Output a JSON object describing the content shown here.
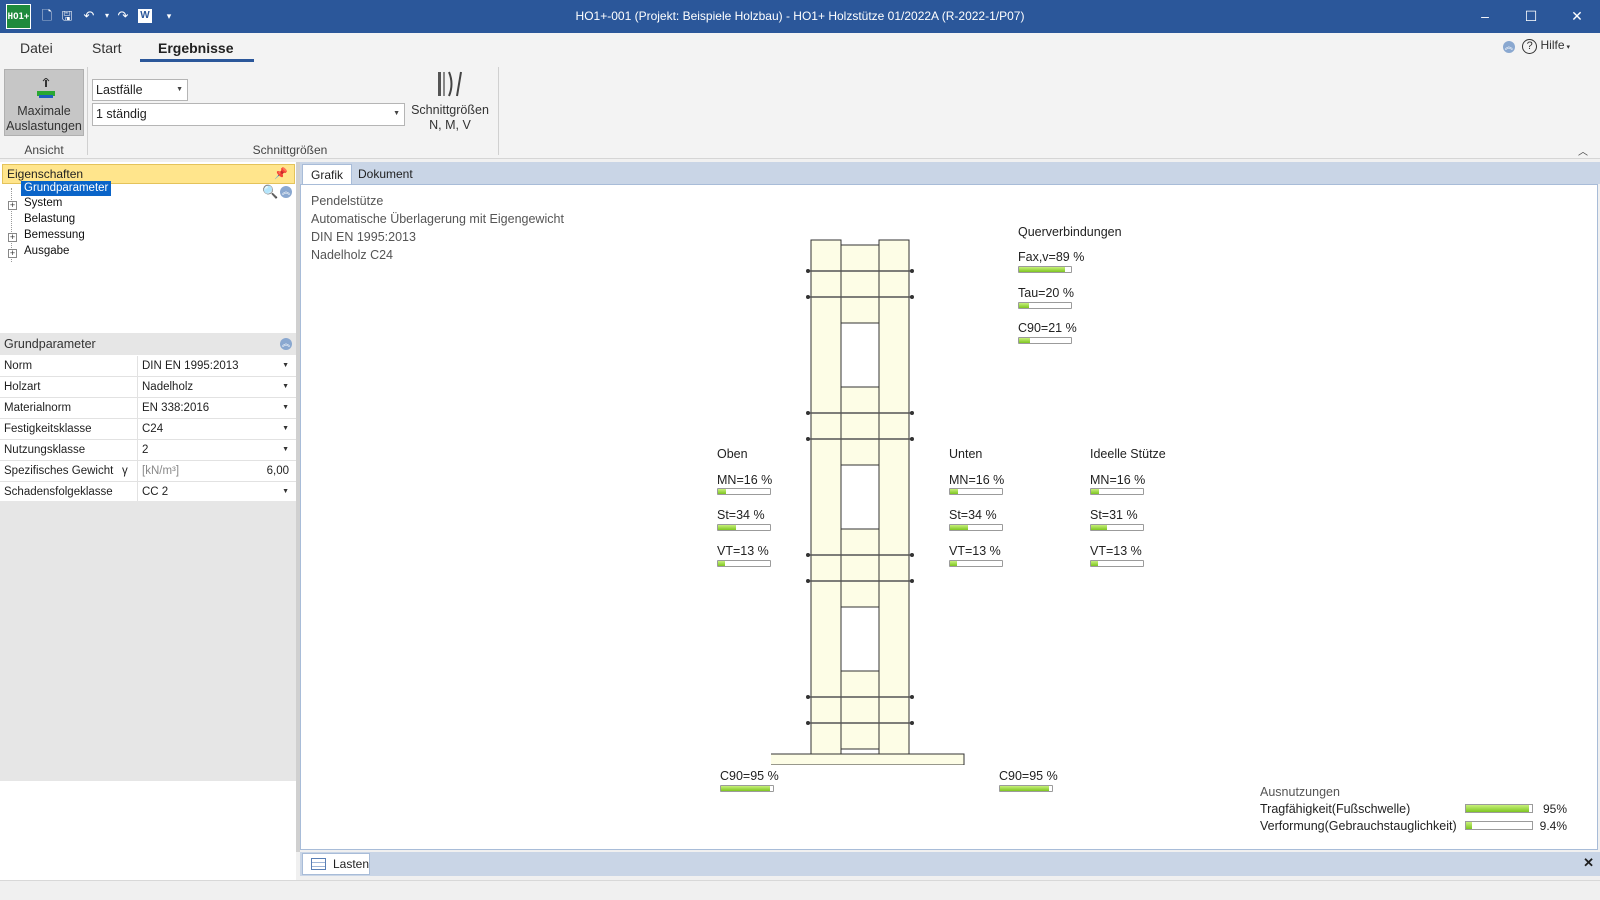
{
  "window": {
    "title": "HO1+-001 (Projekt: Beispiele Holzbau) - HO1+ Holzstütze 01/2022A (R-2022-1/P07)",
    "logo_text": "HO1+",
    "minimize_icon": "–",
    "maximize_icon": "☐",
    "close_icon": "✕"
  },
  "menu": {
    "tabs": [
      "Datei",
      "Start",
      "Ergebnisse"
    ],
    "active_tab": "Ergebnisse",
    "help": "Hilfe"
  },
  "ribbon": {
    "max_btn_line1": "Maximale",
    "max_btn_line2": "Auslastungen",
    "group_ansicht": "Ansicht",
    "dropdown_type": "Lastfälle",
    "dropdown_case": "1 ständig",
    "sg_btn_line1": "Schnittgrößen",
    "sg_btn_line2": "N, M, V",
    "group_schnittgroessen": "Schnittgrößen"
  },
  "left_panel": {
    "header": "Eigenschaften",
    "tree": [
      "Grundparameter",
      "System",
      "Belastung",
      "Bemessung",
      "Ausgabe"
    ],
    "section_title": "Grundparameter",
    "properties": [
      {
        "name": "Norm",
        "value": "DIN EN 1995:2013"
      },
      {
        "name": "Holzart",
        "value": "Nadelholz"
      },
      {
        "name": "Materialnorm",
        "value": "EN 338:2016"
      },
      {
        "name": "Festigkeitsklasse",
        "value": "C24"
      },
      {
        "name": "Nutzungsklasse",
        "value": "2"
      },
      {
        "name": "Spezifisches Gewicht",
        "symbol": "γ",
        "unit": "[kN/m³]",
        "value": "6,00"
      },
      {
        "name": "Schadensfolgeklasse",
        "value": "CC 2"
      }
    ]
  },
  "doc_tabs": [
    "Grafik",
    "Dokument"
  ],
  "graphic": {
    "info": [
      "Pendelstütze",
      "Automatische Überlagerung mit Eigengewicht",
      "DIN EN 1995:2013",
      "Nadelholz C24"
    ],
    "querverbindungen": {
      "title": "Querverbindungen",
      "items": [
        {
          "label": "Fax,v=89 %",
          "value": 0.89
        },
        {
          "label": "Tau=20 %",
          "value": 0.2
        },
        {
          "label": "C90=21 %",
          "value": 0.21
        }
      ]
    },
    "oben": {
      "title": "Oben",
      "items": [
        {
          "label": "MN=16 %",
          "value": 0.16
        },
        {
          "label": "St=34 %",
          "value": 0.34
        },
        {
          "label": "VT=13 %",
          "value": 0.13
        }
      ]
    },
    "unten": {
      "title": "Unten",
      "items": [
        {
          "label": "MN=16 %",
          "value": 0.16
        },
        {
          "label": "St=34 %",
          "value": 0.34
        },
        {
          "label": "VT=13 %",
          "value": 0.13
        }
      ]
    },
    "ideelle": {
      "title": "Ideelle Stütze",
      "items": [
        {
          "label": "MN=16 %",
          "value": 0.16
        },
        {
          "label": "St=31 %",
          "value": 0.31
        },
        {
          "label": "VT=13 %",
          "value": 0.13
        }
      ]
    },
    "c90_left": {
      "label": "C90=95 %",
      "value": 0.95
    },
    "c90_right": {
      "label": "C90=95 %",
      "value": 0.95
    },
    "ausnutzungen": {
      "title": "Ausnutzungen",
      "rows": [
        {
          "label": "Tragfähigkeit(Fußschwelle)",
          "pct": "95%",
          "value": 0.95
        },
        {
          "label": "Verformung(Gebrauchstauglichkeit)",
          "pct": "9.4%",
          "value": 0.094
        }
      ]
    }
  },
  "bottom_tab": "Lasten",
  "colors": {
    "titlebar": "#2b579a",
    "accent": "#2b579a",
    "panel_header": "#ffe58c",
    "bar_fill": "#7ec622",
    "column_fill": "#fdfde6"
  }
}
